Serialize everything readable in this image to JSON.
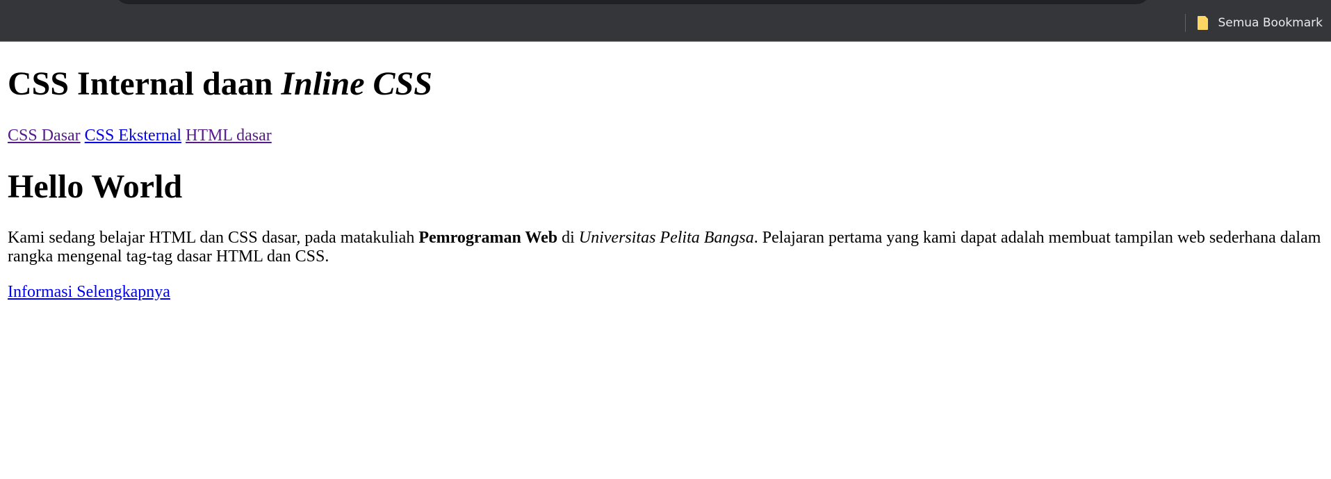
{
  "browser": {
    "bookmarks_bar": {
      "all_bookmarks_label": "Semua Bookmark",
      "folder_icon": "folder-icon",
      "folder_color": "#fdd663"
    }
  },
  "page": {
    "heading": {
      "normal": "CSS Internal daan ",
      "italic": "Inline CSS"
    },
    "nav_links": [
      {
        "label": "CSS Dasar",
        "visited": true
      },
      {
        "label": "CSS Eksternal",
        "visited": false
      },
      {
        "label": "HTML dasar",
        "visited": true
      }
    ],
    "subheading": "Hello World",
    "paragraph": {
      "part1": "Kami sedang belajar HTML dan CSS dasar, pada matakuliah ",
      "bold": "Pemrograman Web",
      "part2": " di ",
      "italic": "Universitas Pelita Bangsa",
      "part3": ". Pelajaran pertama yang kami dapat adalah membuat tampilan web sederhana dalam rangka mengenal tag-tag dasar HTML dan CSS."
    },
    "more_link": "Informasi Selengkapnya"
  },
  "colors": {
    "chrome_bg": "#35363a",
    "link_unvisited": "#0000ee",
    "link_visited": "#551a8b"
  }
}
